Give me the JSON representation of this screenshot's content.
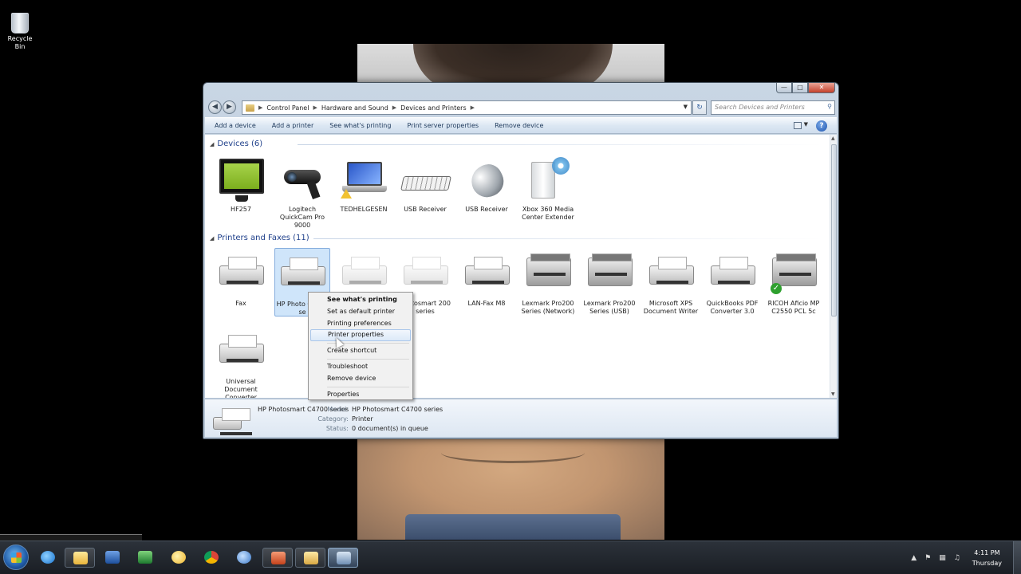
{
  "desktop": {
    "icons": [
      {
        "label": "Recycle Bin",
        "icon": "recycle-bin-icon"
      }
    ]
  },
  "window": {
    "breadcrumb": [
      "Control Panel",
      "Hardware and Sound",
      "Devices and Printers"
    ],
    "search_placeholder": "Search Devices and Printers",
    "commands": [
      "Add a device",
      "Add a printer",
      "See what's printing",
      "Print server properties",
      "Remove device"
    ],
    "groups": {
      "devices": {
        "header": "Devices (6)",
        "items": [
          {
            "label": "HF257",
            "icon": "monitor-icon"
          },
          {
            "label": "Logitech QuickCam Pro 9000",
            "icon": "webcam-icon"
          },
          {
            "label": "TEDHELGESEN",
            "icon": "laptop-icon"
          },
          {
            "label": "USB Receiver",
            "icon": "keyboard-icon"
          },
          {
            "label": "USB Receiver",
            "icon": "mouse-icon"
          },
          {
            "label": "Xbox 360 Media Center Extender",
            "icon": "media-extender-icon"
          }
        ]
      },
      "printers": {
        "header": "Printers and Faxes (11)",
        "items": [
          {
            "label": "Fax",
            "icon": "fax-icon"
          },
          {
            "label": "HP Photo C4700 se",
            "icon": "printer-icon"
          },
          {
            "label": "",
            "icon": "printer-icon"
          },
          {
            "label": "Photosmart 200 series",
            "icon": "printer-icon"
          },
          {
            "label": "LAN-Fax M8",
            "icon": "printer-icon"
          },
          {
            "label": "Lexmark Pro200 Series (Network)",
            "icon": "mfp-icon"
          },
          {
            "label": "Lexmark Pro200 Series (USB)",
            "icon": "printer-icon"
          },
          {
            "label": "Microsoft XPS Document Writer",
            "icon": "printer-icon"
          },
          {
            "label": "QuickBooks PDF Converter 3.0",
            "icon": "printer-icon"
          },
          {
            "label": "RICOH Aficio MP C2550 PCL 5c",
            "icon": "copier-icon"
          },
          {
            "label": "Universal Document Converter",
            "icon": "printer-icon"
          }
        ]
      }
    },
    "context_menu": {
      "items": [
        "See what's printing",
        "Set as default printer",
        "Printing preferences",
        "Printer properties",
        "Create shortcut",
        "Troubleshoot",
        "Remove device",
        "Properties"
      ],
      "highlighted": "Printer properties"
    },
    "details": {
      "name": "HP Photosmart C4700 series",
      "model_key": "Model:",
      "model": "HP Photosmart C4700 series",
      "category_key": "Category:",
      "category": "Printer",
      "status_key": "Status:",
      "status": "0 document(s) in queue"
    }
  },
  "taskbar": {
    "pinned": [
      "internet-explorer-icon",
      "outlook-icon",
      "word-icon",
      "excel-icon",
      "messenger-icon",
      "chrome-icon",
      "itunes-icon",
      "powerpoint-icon",
      "explorer-icon",
      "devices-and-printers-icon"
    ],
    "clock": {
      "time": "4:11 PM",
      "day": "Thursday"
    }
  }
}
